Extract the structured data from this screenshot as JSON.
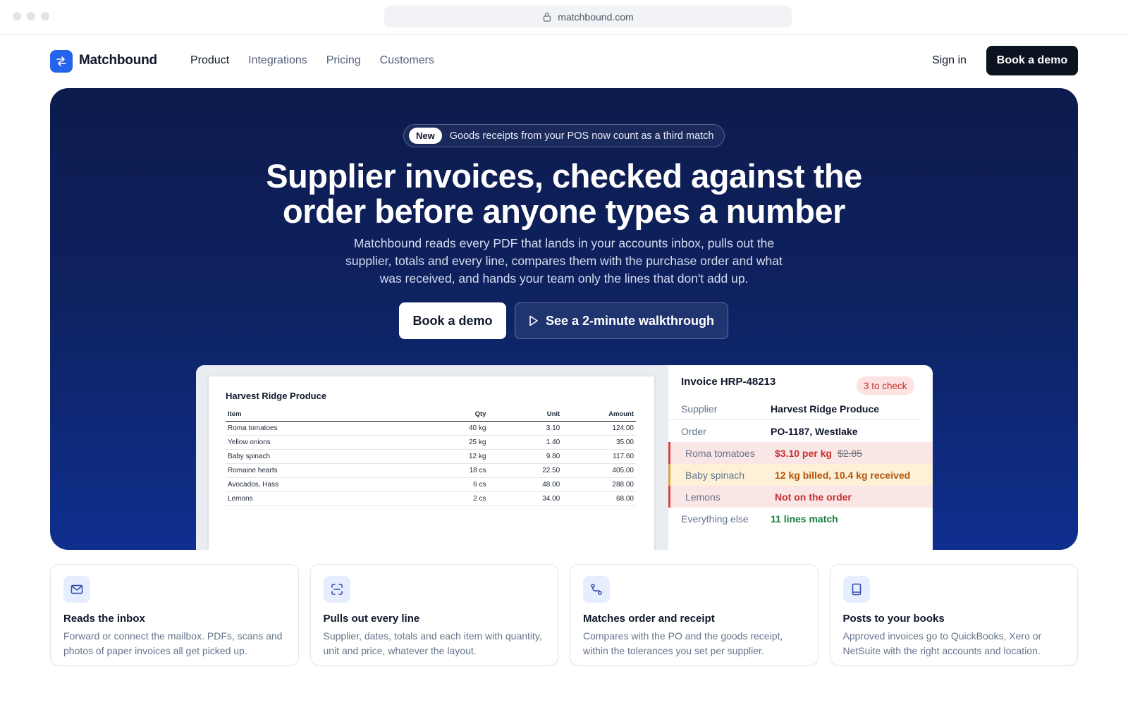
{
  "browser": {
    "url": "matchbound.com"
  },
  "nav": {
    "brand": "Matchbound",
    "links": [
      "Product",
      "Integrations",
      "Pricing",
      "Customers"
    ],
    "active_link": "Product",
    "sign_in": "Sign in",
    "cta": "Book a demo"
  },
  "hero": {
    "badge_tag": "New",
    "badge_text": "Goods receipts from your POS now count as a third match",
    "headline_line1": "Supplier invoices, checked against the",
    "headline_line2": "order before anyone types a number",
    "subtext": "Matchbound reads every PDF that lands in your accounts inbox, pulls out the supplier, totals and every line, compares them with the purchase order and what was received, and hands your team only the lines that don't add up.",
    "primary_button": "Book a demo",
    "secondary_button": "See a 2-minute walkthrough"
  },
  "invoice_document": {
    "supplier": "Harvest Ridge Produce",
    "columns": [
      "Item",
      "Qty",
      "Unit",
      "Amount"
    ],
    "rows": [
      {
        "item": "Roma tomatoes",
        "qty": "40 kg",
        "unit": "3.10",
        "amount": "124.00"
      },
      {
        "item": "Yellow onions",
        "qty": "25 kg",
        "unit": "1.40",
        "amount": "35.00"
      },
      {
        "item": "Baby spinach",
        "qty": "12 kg",
        "unit": "9.80",
        "amount": "117.60"
      },
      {
        "item": "Romaine hearts",
        "qty": "18 cs",
        "unit": "22.50",
        "amount": "405.00"
      },
      {
        "item": "Avocados, Hass",
        "qty": "6 cs",
        "unit": "48.00",
        "amount": "288.00"
      },
      {
        "item": "Lemons",
        "qty": "2 cs",
        "unit": "34.00",
        "amount": "68.00"
      }
    ]
  },
  "check_panel": {
    "title": "Invoice HRP-48213",
    "badge": "3 to check",
    "supplier_label": "Supplier",
    "supplier_value": "Harvest Ridge Produce",
    "order_label": "Order",
    "order_value": "PO-1187, Westlake",
    "issues": [
      {
        "label": "Roma tomatoes",
        "value": "$3.10 per kg",
        "old_value": "$2.85",
        "severity": "error"
      },
      {
        "label": "Baby spinach",
        "value": "12 kg billed, 10.4 kg received",
        "severity": "warning"
      },
      {
        "label": "Lemons",
        "value": "Not on the order",
        "severity": "error"
      }
    ],
    "else_label": "Everything else",
    "else_value": "11 lines match",
    "colors": {
      "error": "#c53030",
      "warning": "#b45309",
      "ok": "#15803d"
    }
  },
  "features": [
    {
      "icon": "mail-icon",
      "title": "Reads the inbox",
      "text": "Forward or connect the mailbox. PDFs, scans and photos of paper invoices all get picked up."
    },
    {
      "icon": "scan-icon",
      "title": "Pulls out every line",
      "text": "Supplier, dates, totals and each item with quantity, unit and price, whatever the layout."
    },
    {
      "icon": "route-icon",
      "title": "Matches order and receipt",
      "text": "Compares with the PO and the goods receipt, within the tolerances you set per supplier."
    },
    {
      "icon": "book-icon",
      "title": "Posts to your books",
      "text": "Approved invoices go to QuickBooks, Xero or NetSuite with the right accounts and location."
    }
  ],
  "theme": {
    "accent": "#2563eb",
    "hero_bg": "#0e2260",
    "cta_dark": "#0b1220"
  }
}
